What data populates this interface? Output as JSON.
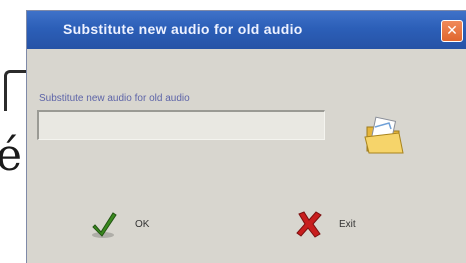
{
  "window": {
    "title": "Substitute new audio for old audio",
    "close_glyph": "✕"
  },
  "form": {
    "label": "Substitute new audio for old audio",
    "path_value": "",
    "browse_icon": "folder-open-icon"
  },
  "buttons": {
    "ok_label": "OK",
    "ok_icon": "checkmark-icon",
    "exit_label": "Exit",
    "exit_icon": "red-x-icon"
  },
  "colors": {
    "titlebar": "#2c5fb8",
    "title_text": "#eef2ff",
    "dialog_bg": "#d8d6cf",
    "close_button": "#e0662e",
    "label_text": "#5d64a8",
    "ok_check": "#3a8a1f",
    "exit_x": "#c81e1e"
  }
}
